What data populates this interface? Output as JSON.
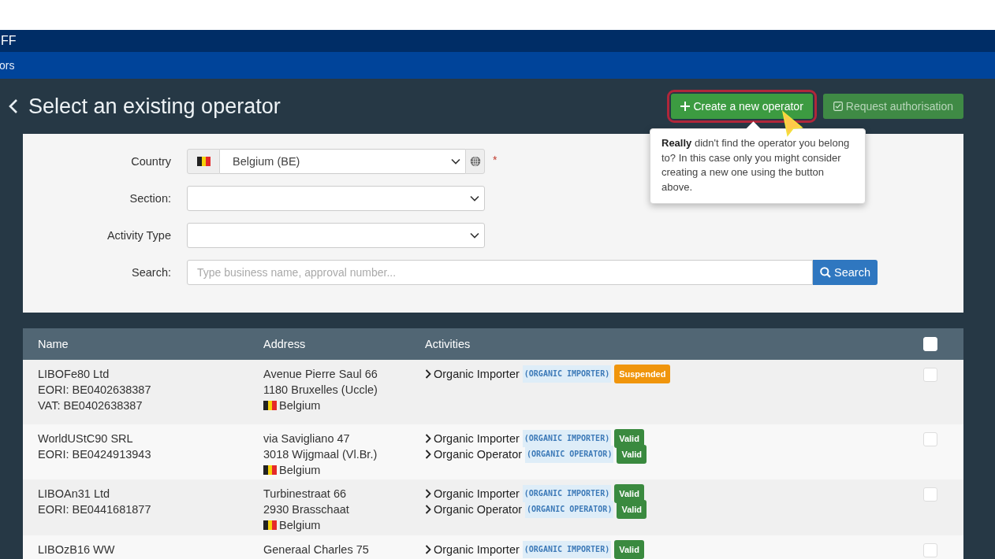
{
  "top_bar": {
    "title": "FF"
  },
  "nav_bar": {
    "item": "ors"
  },
  "page": {
    "title": "Select an existing operator"
  },
  "actions": [
    {
      "kind": "create",
      "label": "Create a new operator",
      "highlighted": true
    },
    {
      "kind": "request",
      "label": "Request authorisation",
      "highlighted": false
    }
  ],
  "tooltip": {
    "text": "**Really** didn't find the operator you belong to? In this case only you might consider creating a new one using the button above."
  },
  "form": {
    "fields": [
      {
        "kind": "country",
        "label": "Country",
        "value": "Belgium (BE)",
        "required_mark": "*"
      },
      {
        "kind": "select",
        "label": "Section:"
      },
      {
        "kind": "select",
        "label": "Activity Type"
      },
      {
        "kind": "search",
        "label": "Search:",
        "placeholder": "Type business name, approval number...",
        "button": "Search"
      }
    ]
  },
  "table": {
    "columns": [
      "Name",
      "Address",
      "Activities"
    ],
    "select_all": {
      "checked": false
    },
    "rows": [
      {
        "name_lines": [
          "LIBOFe80 Ltd",
          "EORI: BE0402638387",
          "VAT: BE0402638387"
        ],
        "address_lines": [
          "Avenue Pierre Saul 66",
          "1180 Bruxelles (Uccle)"
        ],
        "country": "Belgium",
        "activities": [
          {
            "name": "Organic Importer",
            "code": "(ORGANIC IMPORTER)",
            "status": "Suspended",
            "color": "#f0950c"
          }
        ],
        "checked": false
      },
      {
        "name_lines": [
          "WorldUStC90 SRL",
          "EORI: BE0424913943"
        ],
        "address_lines": [
          "via Savigliano 47",
          "3018 Wijgmaal (Vl.Br.)"
        ],
        "country": "Belgium",
        "activities": [
          {
            "name": "Organic Importer",
            "code": "(ORGANIC IMPORTER)",
            "status": "Valid",
            "color": "#3a8a3f"
          },
          {
            "name": "Organic Operator",
            "code": "(ORGANIC OPERATOR)",
            "status": "Valid",
            "color": "#3a8a3f"
          }
        ],
        "checked": false
      },
      {
        "name_lines": [
          "LIBOAn31 Ltd",
          "EORI: BE0441681877"
        ],
        "address_lines": [
          "Turbinestraat 66",
          "2930 Brasschaat"
        ],
        "country": "Belgium",
        "activities": [
          {
            "name": "Organic Importer",
            "code": "(ORGANIC IMPORTER)",
            "status": "Valid",
            "color": "#3a8a3f"
          },
          {
            "name": "Organic Operator",
            "code": "(ORGANIC OPERATOR)",
            "status": "Valid",
            "color": "#3a8a3f"
          }
        ],
        "checked": false
      },
      {
        "name_lines": [
          "LIBOzB16 WW"
        ],
        "address_lines": [
          "Generaal Charles 75"
        ],
        "activities": [
          {
            "name": "Organic Importer",
            "code": "(ORGANIC IMPORTER)",
            "status": "Valid",
            "color": "#3a8a3f"
          }
        ],
        "checked": false
      }
    ]
  }
}
